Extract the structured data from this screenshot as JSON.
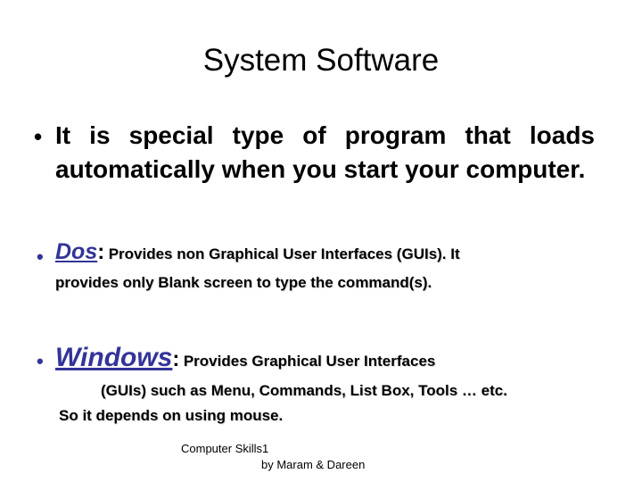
{
  "slide": {
    "title": "System Software",
    "background_color": "#ffffff",
    "text_color": "#000000",
    "accent_color": "#333399"
  },
  "bullets": {
    "intro": {
      "marker": "•",
      "text": "It is special type of program that loads automatically when you start your computer."
    },
    "dos": {
      "marker": "•",
      "term": "Dos",
      "colon": ":",
      "description_line_1": "Provides non Graphical User Interfaces (GUIs). It",
      "description_line_2": "provides only Blank screen to type the command(s)."
    },
    "windows": {
      "marker": "•",
      "term": "Windows",
      "colon": ":",
      "description_line_1": "Provides Graphical User Interfaces",
      "description_line_2": "(GUIs) such as Menu, Commands, List Box, Tools … etc.",
      "description_line_3": "So it depends on using mouse."
    }
  },
  "footer": {
    "line_1": "Computer Skills1",
    "line_2": "by Maram & Dareen"
  }
}
